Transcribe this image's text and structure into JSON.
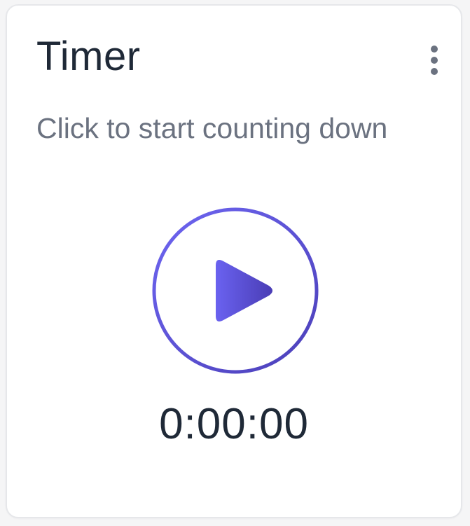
{
  "widget": {
    "title": "Timer",
    "subtitle": "Click to start counting down",
    "time": "0:00:00",
    "play_icon": "play-icon",
    "menu_icon": "more-vertical-icon"
  },
  "colors": {
    "gradient_start": "#6c63ff",
    "gradient_end": "#4a3db5",
    "title": "#1f2937",
    "subtitle": "#6b7280",
    "border": "#e6e7ea"
  }
}
